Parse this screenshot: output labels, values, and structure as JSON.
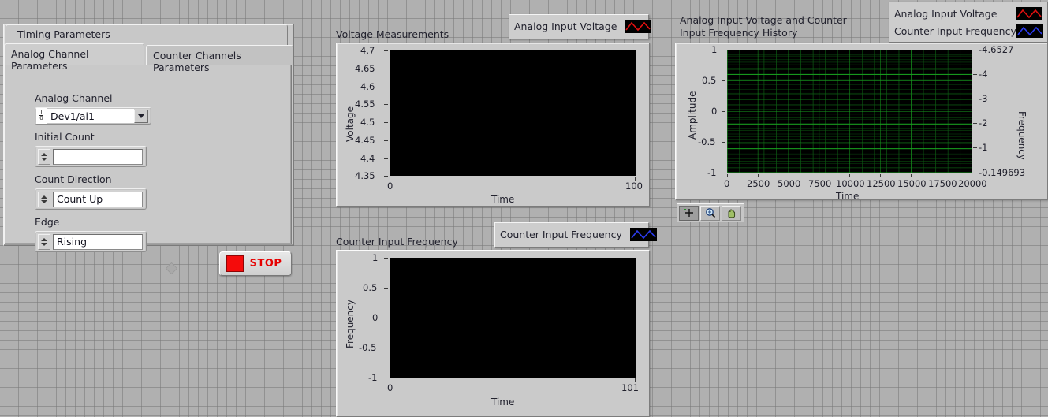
{
  "tab_control": {
    "outer_tab_label": "Timing Parameters",
    "tabs": [
      {
        "label": "Analog Channel Parameters",
        "active": true
      },
      {
        "label": "Counter Channels Parameters",
        "active": false
      }
    ],
    "controls": [
      {
        "label": "Analog Channel",
        "value": "Dev1/ai1",
        "type": "io-combo"
      },
      {
        "label": "Initial Count",
        "value": "",
        "type": "numeric-spinner"
      },
      {
        "label": "Count Direction",
        "value": "Count Up",
        "type": "enum-spinner"
      },
      {
        "label": "Edge",
        "value": "Rising",
        "type": "enum-spinner"
      }
    ]
  },
  "stop_button": {
    "label": "STOP",
    "led_color": "#f50b0b",
    "text_color": "#e60000"
  },
  "charts": [
    {
      "id": "voltage",
      "title": "Voltage Measurements",
      "legend": [
        {
          "name": "Analog Input Voltage",
          "color": "#e01010"
        }
      ],
      "chart_data": {
        "type": "line",
        "title": "Voltage Measurements",
        "xlabel": "Time",
        "ylabel": "Voltage",
        "xlim": [
          0,
          100
        ],
        "ylim": [
          4.35,
          4.7
        ],
        "xticks": [
          "0",
          "100"
        ],
        "yticks": [
          "4.7",
          "4.65",
          "4.6",
          "4.55",
          "4.5",
          "4.45",
          "4.4",
          "4.35"
        ],
        "grid": false,
        "series": [
          {
            "name": "Analog Input Voltage",
            "color": "#e01010",
            "values": []
          }
        ]
      }
    },
    {
      "id": "counter",
      "title": "Counter Input Frequency",
      "legend": [
        {
          "name": "Counter Input Frequency",
          "color": "#2b3bf0"
        }
      ],
      "chart_data": {
        "type": "line",
        "title": "Counter Input Frequency",
        "xlabel": "Time",
        "ylabel": "Frequency",
        "xlim": [
          0,
          101
        ],
        "ylim": [
          -1,
          1
        ],
        "xticks": [
          "0",
          "101"
        ],
        "yticks": [
          "1",
          "0.5",
          "0",
          "-0.5",
          "-1"
        ],
        "grid": false,
        "series": [
          {
            "name": "Counter Input Frequency",
            "color": "#2b3bf0",
            "values": []
          }
        ]
      }
    },
    {
      "id": "history",
      "title_line1": "Analog Input Voltage and Counter",
      "title_line2": "Input Frequency History",
      "legend": [
        {
          "name": "Analog Input Voltage",
          "color": "#e01010"
        },
        {
          "name": "Counter Input Frequency",
          "color": "#2b3bf0"
        }
      ],
      "chart_data": {
        "type": "line",
        "title": "Analog Input Voltage and Counter Input Frequency History",
        "xlabel": "Time",
        "ylabel": "Amplitude",
        "y2label": "Frequency",
        "xlim": [
          0,
          20000
        ],
        "ylim": [
          -1,
          1
        ],
        "y2lim": [
          -4.6527,
          -0.149693
        ],
        "xticks": [
          "0",
          "2500",
          "5000",
          "7500",
          "10000",
          "12500",
          "15000",
          "17500",
          "20000"
        ],
        "yticks": [
          "1",
          "0.5",
          "0",
          "-0.5",
          "-1"
        ],
        "y2ticks": [
          "-4.6527",
          "-4",
          "-3",
          "-2",
          "-1",
          "-0.149693"
        ],
        "grid": true,
        "grid_color": "#0a7a12",
        "plot_bg": "#000000",
        "series": [
          {
            "name": "Analog Input Voltage",
            "color": "#e01010",
            "values": []
          },
          {
            "name": "Counter Input Frequency",
            "color": "#2b3bf0",
            "values": []
          }
        ]
      }
    }
  ],
  "graph_palette": {
    "buttons": [
      {
        "name": "cursor-tool",
        "selected": true
      },
      {
        "name": "zoom-tool",
        "selected": false
      },
      {
        "name": "pan-tool",
        "selected": false
      }
    ]
  }
}
